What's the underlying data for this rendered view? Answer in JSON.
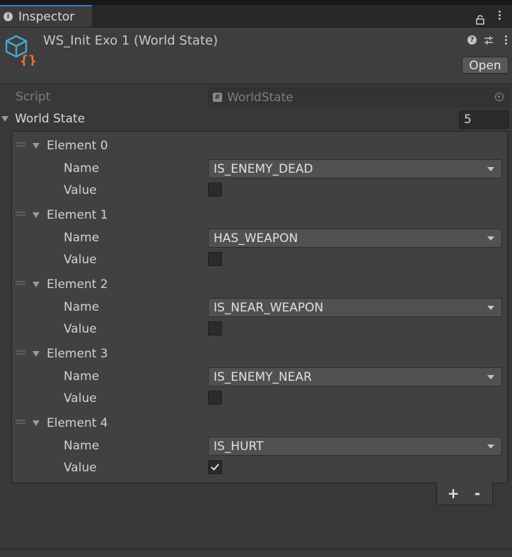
{
  "tab": {
    "label": "Inspector"
  },
  "header": {
    "title": "WS_Init Exo 1 (World State)",
    "open_button": "Open"
  },
  "script_row": {
    "label": "Script",
    "value": "WorldState"
  },
  "world_state": {
    "label": "World State",
    "count": "5",
    "elements": [
      {
        "label": "Element 0",
        "name_label": "Name",
        "name_value": "IS_ENEMY_DEAD",
        "value_label": "Value",
        "checked": false
      },
      {
        "label": "Element 1",
        "name_label": "Name",
        "name_value": "HAS_WEAPON",
        "value_label": "Value",
        "checked": false
      },
      {
        "label": "Element 2",
        "name_label": "Name",
        "name_value": "IS_NEAR_WEAPON",
        "value_label": "Value",
        "checked": false
      },
      {
        "label": "Element 3",
        "name_label": "Name",
        "name_value": "IS_ENEMY_NEAR",
        "value_label": "Value",
        "checked": false
      },
      {
        "label": "Element 4",
        "name_label": "Name",
        "name_value": "IS_HURT",
        "value_label": "Value",
        "checked": true
      }
    ]
  },
  "list_footer": {
    "add": "+",
    "remove": "-"
  },
  "colors": {
    "accent": "#3a79bb",
    "background": "#383838",
    "icon_blue": "#4aa3d8",
    "icon_orange": "#e8713a"
  }
}
